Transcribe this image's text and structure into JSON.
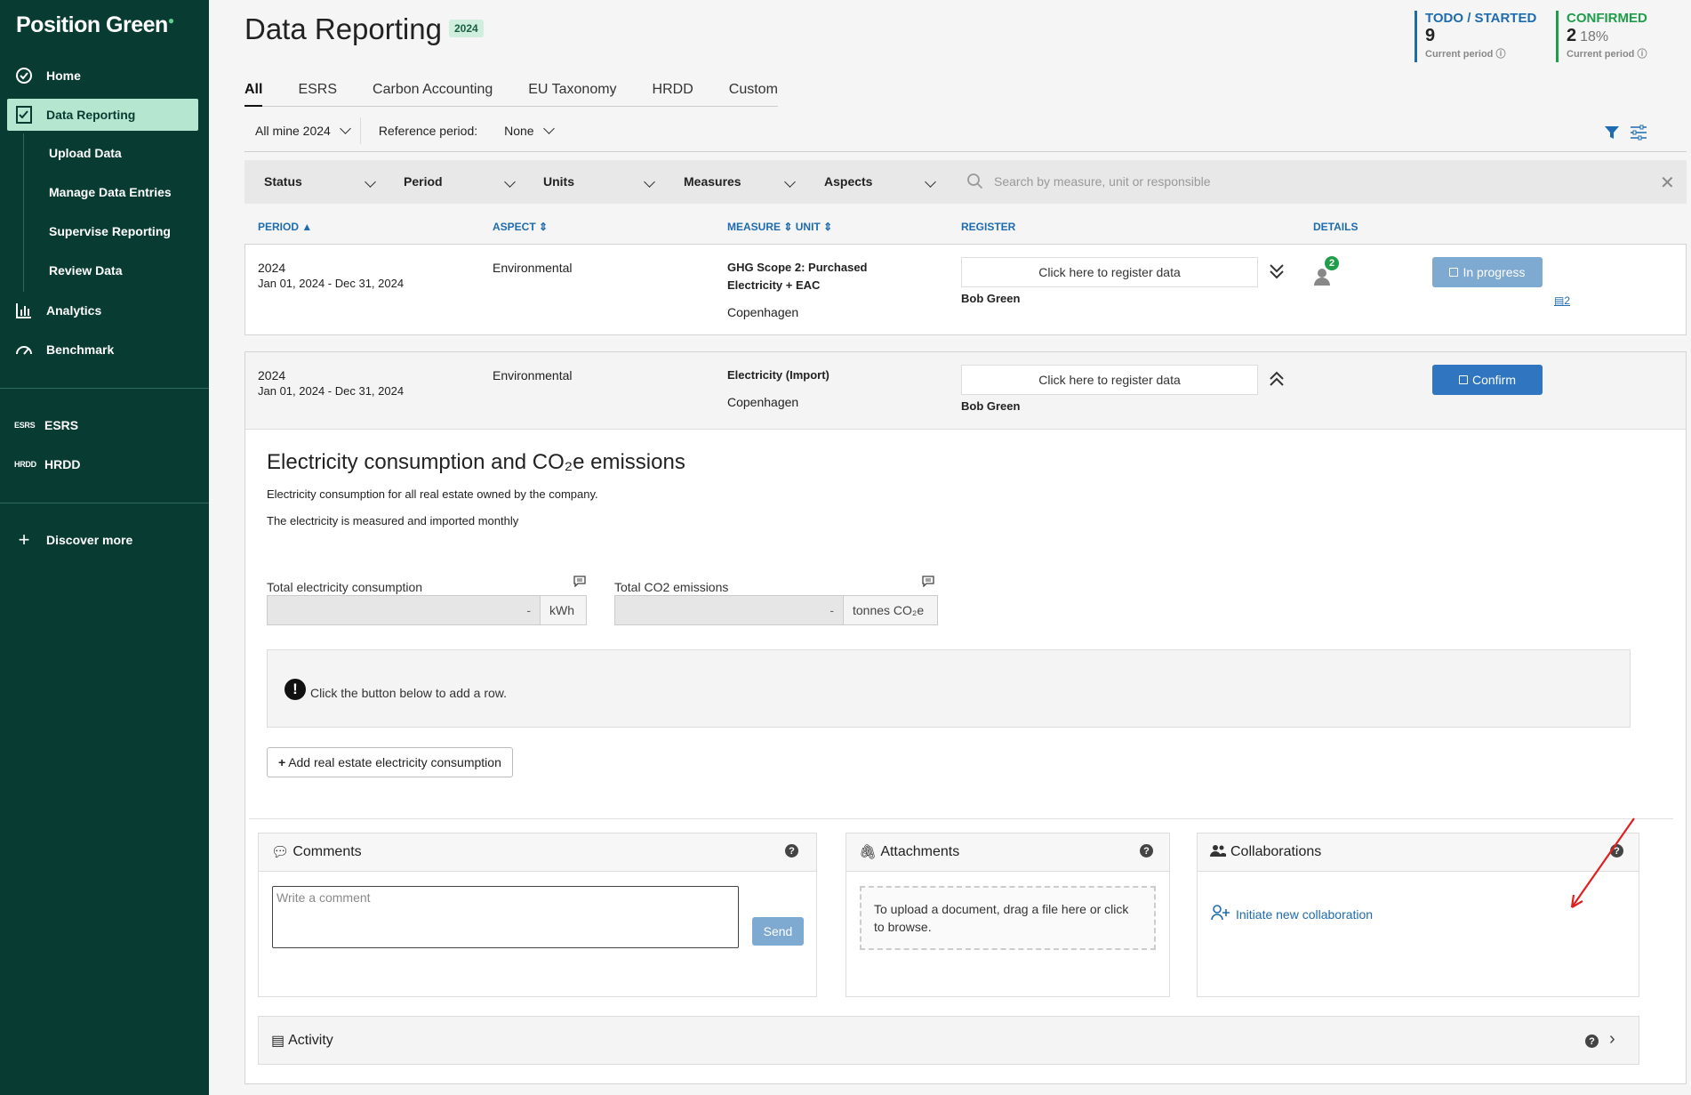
{
  "sidebar": {
    "brand": "Position Green",
    "items": [
      {
        "label": "Home"
      },
      {
        "label": "Data Reporting"
      },
      {
        "label": "Analytics"
      },
      {
        "label": "Benchmark"
      }
    ],
    "subitems": [
      "Upload Data",
      "Manage Data Entries",
      "Supervise Reporting",
      "Review Data"
    ],
    "frameworks": [
      {
        "icon_text": "ESRS",
        "label": "ESRS"
      },
      {
        "icon_text": "HRDD",
        "label": "HRDD"
      }
    ],
    "discover": "Discover more"
  },
  "header": {
    "title": "Data Reporting",
    "year_badge": "2024",
    "stats": {
      "todo": {
        "label": "TODO / STARTED",
        "value": "9",
        "sub": "Current period",
        "color": "#1e6bb0"
      },
      "confirmed": {
        "label": "CONFIRMED",
        "value": "2",
        "pct": "18%",
        "sub": "Current period",
        "color": "#1f9d4a"
      }
    }
  },
  "tabs": [
    "All",
    "ESRS",
    "Carbon Accounting",
    "EU Taxonomy",
    "HRDD",
    "Custom"
  ],
  "filters": {
    "scope": "All mine 2024",
    "reference_label": "Reference period:",
    "reference_value": "None"
  },
  "filterbar": {
    "items": [
      "Status",
      "Period",
      "Units",
      "Measures",
      "Aspects"
    ],
    "search_placeholder": "Search by measure, unit or responsible"
  },
  "columns": {
    "period": "PERIOD",
    "aspect": "ASPECT",
    "measure": "MEASURE",
    "unit": "UNIT",
    "register": "REGISTER",
    "details": "DETAILS"
  },
  "rows": [
    {
      "year": "2024",
      "range": "Jan 01, 2024 - Dec 31, 2024",
      "aspect": "Environmental",
      "measure_line1": "GHG Scope 2: Purchased",
      "measure_line2": "Electricity + EAC",
      "location": "Copenhagen",
      "register": "Click here to register data",
      "responsible": "Bob Green",
      "collab_count": "2",
      "status": "In progress",
      "comment_count": "2"
    },
    {
      "year": "2024",
      "range": "Jan 01, 2024 - Dec 31, 2024",
      "aspect": "Environmental",
      "measure_line1": "Electricity (Import)",
      "location": "Copenhagen",
      "register": "Click here to register data",
      "responsible": "Bob Green",
      "status": "Confirm"
    }
  ],
  "detail": {
    "title": "Electricity consumption and CO₂e emissions",
    "desc1": "Electricity consumption for all real estate owned by the company.",
    "desc2": "The electricity is measured and imported monthly",
    "field1_label": "Total electricity consumption",
    "field1_value": "-",
    "field1_unit": "kWh",
    "field2_label": "Total CO2 emissions",
    "field2_value": "-",
    "field2_unit": "tonnes CO₂e",
    "info_text": "Click the button below to add a row.",
    "add_button": "Add real estate electricity consumption"
  },
  "panels": {
    "comments": {
      "title": "Comments",
      "placeholder": "Write a comment",
      "send": "Send"
    },
    "attachments": {
      "title": "Attachments",
      "drop_text": "To upload a document, drag a file here or click to browse."
    },
    "collaborations": {
      "title": "Collaborations",
      "link": "Initiate new collaboration"
    },
    "activity": {
      "title": "Activity"
    }
  }
}
